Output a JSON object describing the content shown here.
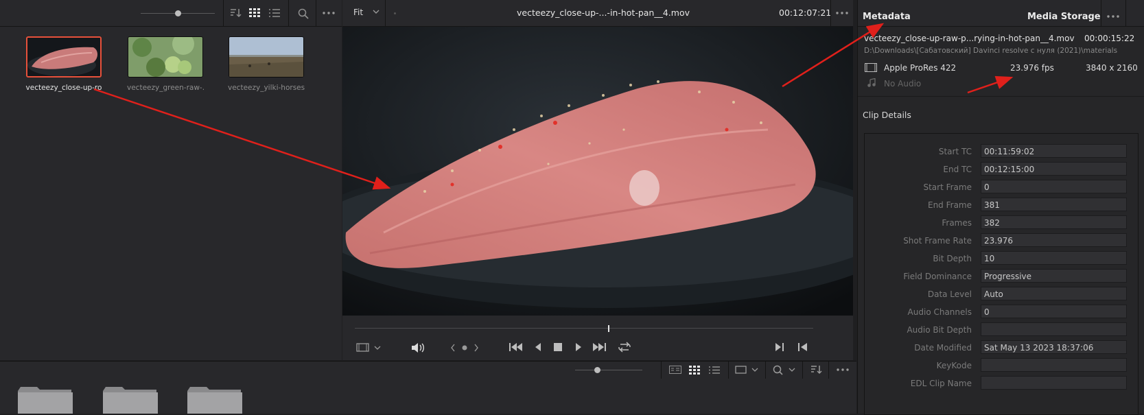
{
  "media_pool": {
    "clips": [
      {
        "label": "vecteezy_close-up-ro",
        "selected": true
      },
      {
        "label": "vecteezy_green-raw-...",
        "selected": false
      },
      {
        "label": "vecteezy_yilki-horses...",
        "selected": false
      }
    ]
  },
  "viewer": {
    "zoom_label": "Fit",
    "clip_title": "vecteezy_close-up-...-in-hot-pan__4.mov",
    "timecode": "00:12:07:21"
  },
  "inspector": {
    "tab_metadata": "Metadata",
    "tab_media_storage": "Media Storage",
    "file_name": "vecteezy_close-up-raw-p...rying-in-hot-pan__4.mov",
    "duration": "00:00:15:22",
    "path": "D:\\Downloads\\[Сабатовский] Davinci resolve с нуля (2021)\\materials",
    "codec": "Apple ProRes 422",
    "fps": "23.976 fps",
    "resolution": "3840 x 2160",
    "audio": "No Audio",
    "clip_details_title": "Clip Details",
    "fields": [
      {
        "label": "Start TC",
        "value": "00:11:59:02"
      },
      {
        "label": "End TC",
        "value": "00:12:15:00"
      },
      {
        "label": "Start Frame",
        "value": "0"
      },
      {
        "label": "End Frame",
        "value": "381"
      },
      {
        "label": "Frames",
        "value": "382"
      },
      {
        "label": "Shot Frame Rate",
        "value": "23.976"
      },
      {
        "label": "Bit Depth",
        "value": "10"
      },
      {
        "label": "Field Dominance",
        "value": "Progressive"
      },
      {
        "label": "Data Level",
        "value": "Auto"
      },
      {
        "label": "Audio Channels",
        "value": "0"
      },
      {
        "label": "Audio Bit Depth",
        "value": ""
      },
      {
        "label": "Date Modified",
        "value": "Sat May 13 2023 18:37:06"
      },
      {
        "label": "KeyKode",
        "value": ""
      },
      {
        "label": "EDL Clip Name",
        "value": ""
      }
    ]
  },
  "colors": {
    "panel": "#28282b",
    "background": "#1f1f21",
    "selection": "#e8513b",
    "annotation_arrow": "#e0201b"
  },
  "icons": [
    "sort-icon",
    "grid-view-icon",
    "list-view-icon",
    "search-icon",
    "more-icon",
    "chevron-down-icon",
    "play-icon",
    "stop-icon",
    "loop-icon",
    "volume-icon",
    "folder-icon",
    "audio-note-icon",
    "film-icon",
    "skip-start-icon",
    "skip-end-icon",
    "step-back-icon",
    "step-forward-icon",
    "mark-in-icon",
    "mark-out-icon",
    "clip-view-icon",
    "zoom-slider"
  ]
}
